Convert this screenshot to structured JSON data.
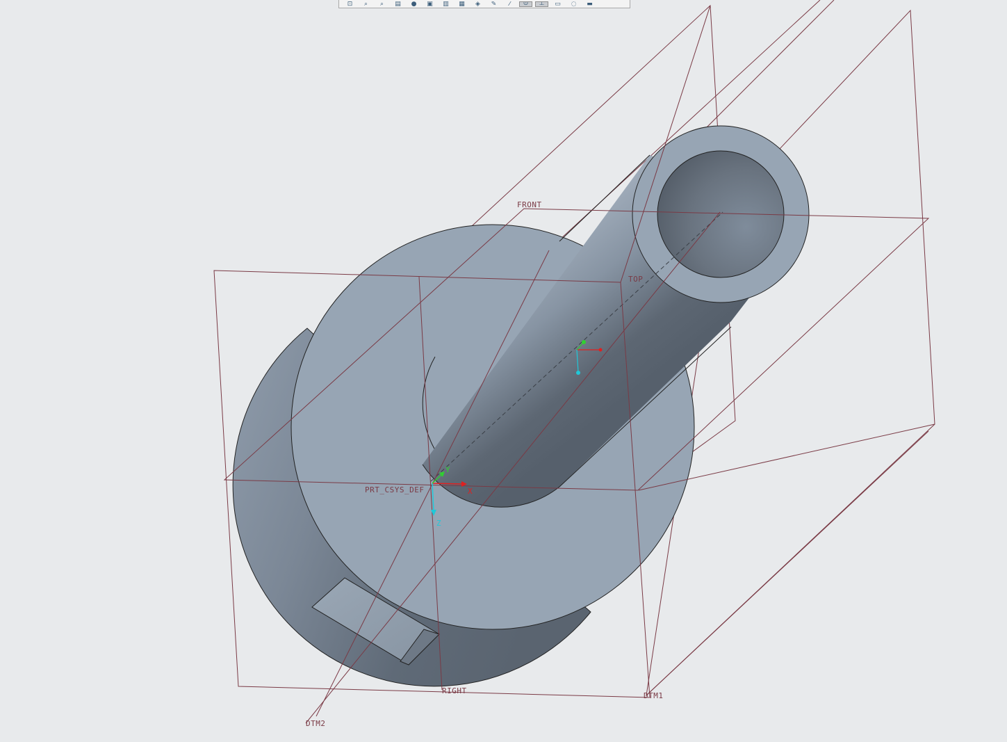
{
  "toolbar": {
    "buttons": [
      {
        "name": "refit-view-button",
        "glyph": "⊡"
      },
      {
        "name": "zoom-in-button",
        "glyph": "⌕"
      },
      {
        "name": "zoom-out-button",
        "glyph": "⌕"
      },
      {
        "name": "repaint-button",
        "glyph": "▤"
      },
      {
        "name": "display-style-button",
        "glyph": "●"
      },
      {
        "name": "saved-views-button",
        "glyph": "▣"
      },
      {
        "name": "named-view-button",
        "glyph": "▥"
      },
      {
        "name": "view-manager-button",
        "glyph": "▦"
      },
      {
        "name": "perspective-button",
        "glyph": "◈"
      },
      {
        "name": "annotation-display-button",
        "glyph": "✎"
      },
      {
        "name": "datum-display-button",
        "glyph": "⁄"
      },
      {
        "name": "spin-center-button",
        "glyph": "⊙",
        "active": true
      },
      {
        "name": "csys-display-button",
        "glyph": "⊥",
        "active": true
      },
      {
        "name": "layers-button",
        "glyph": "▭"
      },
      {
        "name": "appearance-button",
        "glyph": "◌"
      },
      {
        "name": "more-button",
        "glyph": "▬"
      }
    ]
  },
  "datums": {
    "front": "FRONT",
    "top": "TOP",
    "right": "RIGHT",
    "dtm1": "DTM1",
    "dtm2": "DTM2",
    "csys": "PRT_CSYS_DEF"
  },
  "axes": {
    "x": "X",
    "y": "Y",
    "z": "Z"
  },
  "colors": {
    "background": "#e8eaec",
    "datum_plane": "#7a3a45",
    "model_light": "#97a5b4",
    "model_dark": "#5a6470",
    "axis_x": "#e02020",
    "axis_y": "#30d030",
    "axis_z": "#20c8d8"
  }
}
